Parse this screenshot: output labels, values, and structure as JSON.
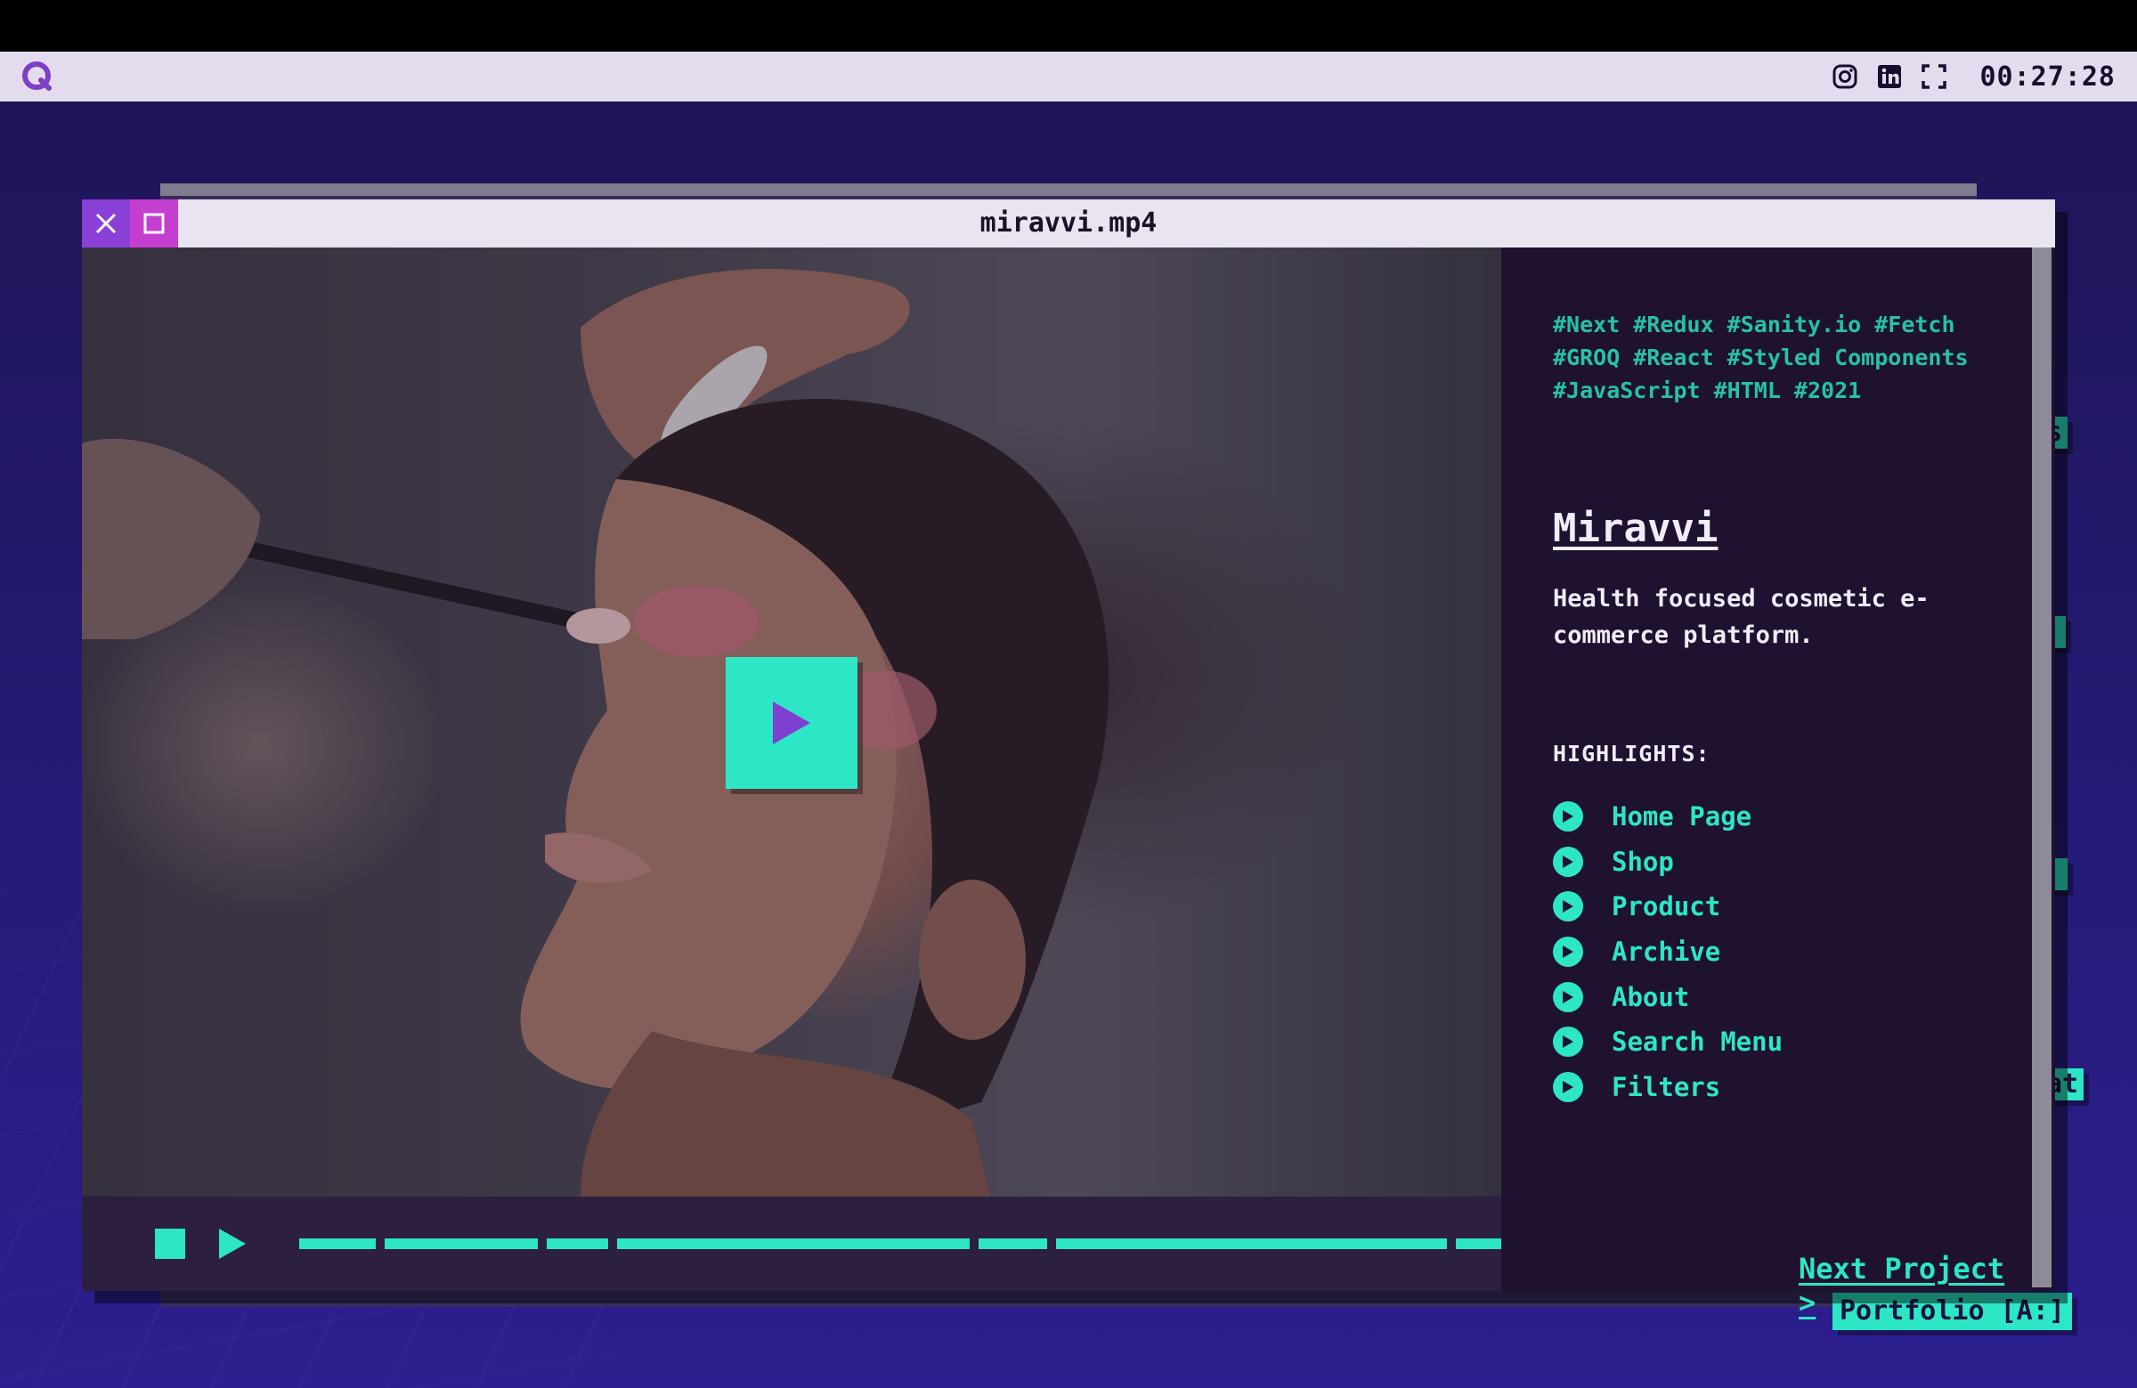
{
  "menubar": {
    "logo_icon": "q-logo-icon",
    "clock": "00:27:28",
    "icons": [
      "instagram-icon",
      "linkedin-icon",
      "fullscreen-icon"
    ]
  },
  "background": {
    "portfolio_tag": "Portfolio [A:]",
    "side_tabs": [
      "s",
      "at"
    ]
  },
  "window": {
    "title": "miravvi.mp4",
    "close_icon": "close-icon",
    "maximize_icon": "maximize-icon"
  },
  "project": {
    "tags": "#Next #Redux #Sanity.io #Fetch #GROQ #React #Styled Components #JavaScript #HTML #2021",
    "title": "Miravvi",
    "description": "Health focused cosmetic e-commerce platform.",
    "highlights_label": "HIGHLIGHTS:",
    "highlights": [
      "Home Page",
      "Shop",
      "Product",
      "Archive",
      "About",
      "Search Menu",
      "Filters"
    ],
    "next_label": "Next Project >"
  },
  "player": {
    "progress_segments": [
      1,
      2,
      0.8,
      4.6,
      0.9,
      5.1,
      0.7
    ]
  },
  "colors": {
    "accent": "#2de6c5",
    "panel": "#1e1230",
    "close_btn": "#8a3fd6",
    "max_btn": "#c43ed0"
  }
}
